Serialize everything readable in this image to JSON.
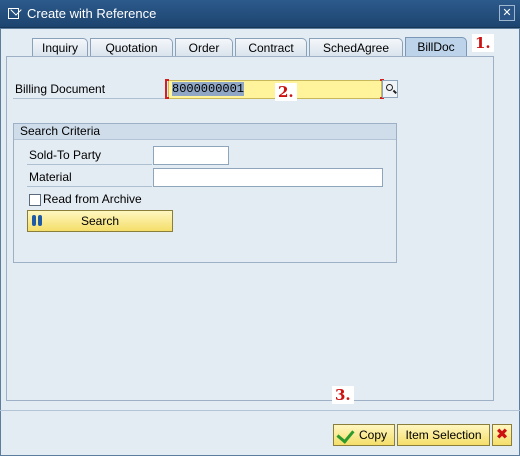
{
  "window": {
    "title": "Create with Reference",
    "close_glyph": "✕"
  },
  "tabs": [
    {
      "label": "Inquiry"
    },
    {
      "label": "Quotation"
    },
    {
      "label": "Order"
    },
    {
      "label": "Contract"
    },
    {
      "label": "SchedAgree"
    },
    {
      "label": "BillDoc"
    }
  ],
  "active_tab": "BillDoc",
  "markers": [
    "1.",
    "2.",
    "3."
  ],
  "billing_document": {
    "label": "Billing Document",
    "value": "8000000001"
  },
  "search_criteria": {
    "title": "Search Criteria",
    "sold_to_label": "Sold-To Party",
    "sold_to_value": "",
    "material_label": "Material",
    "material_value": "",
    "archive_label": "Read from Archive",
    "archive_checked": false,
    "search_button": "Search"
  },
  "footer": {
    "copy_button": "Copy",
    "item_selection_button": "Item Selection",
    "cancel_glyph": "✖"
  },
  "colors": {
    "titlebar": "#1d446f",
    "accent_yellow": "#fff39b",
    "marker_red": "#cc1111",
    "active_tab": "#bcd3ea"
  },
  "icons": [
    "window-icon",
    "close-icon",
    "f4-help-icon",
    "binoculars-icon",
    "checkmark-icon",
    "cancel-icon"
  ]
}
